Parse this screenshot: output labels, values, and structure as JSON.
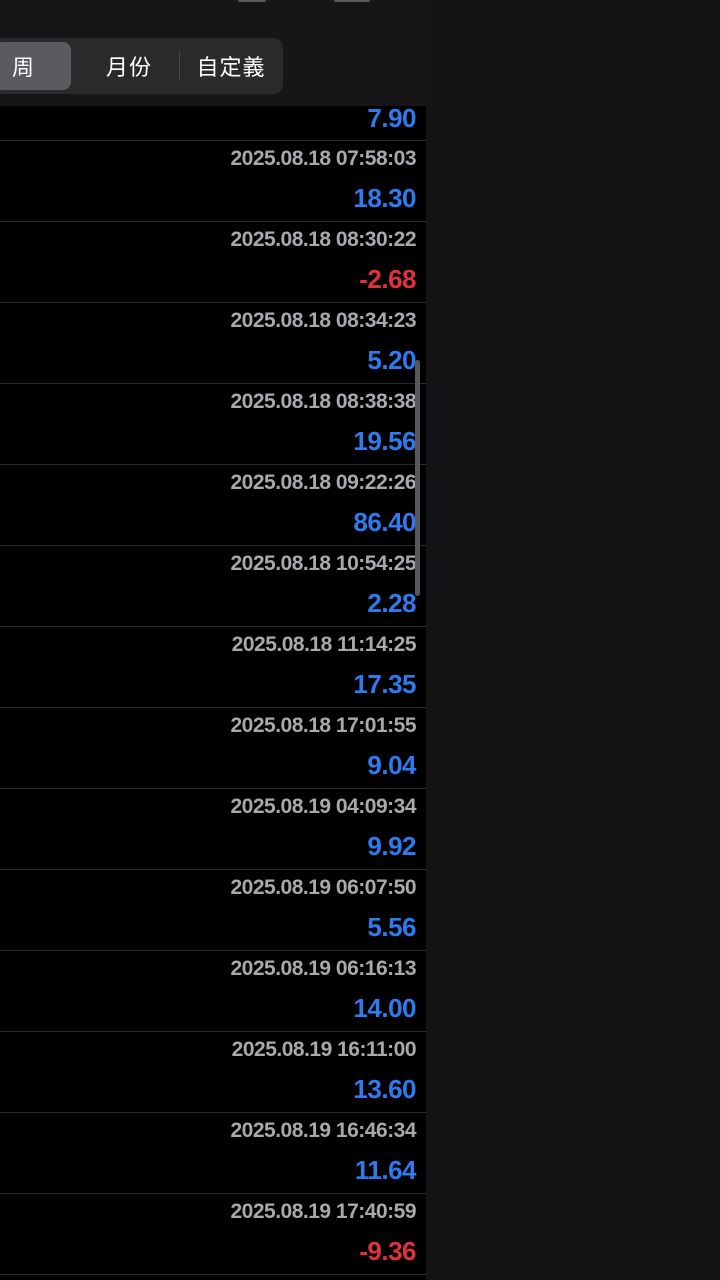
{
  "period_selector": {
    "week_label": "周",
    "month_label": "月份",
    "custom_label": "自定義",
    "selected": "week"
  },
  "colors": {
    "positive": "#2e7bf0",
    "negative": "#e0323c"
  },
  "first_row_value": "7.90",
  "rows": [
    {
      "timestamp": "2025.08.18 07:58:03",
      "profit": "18.30",
      "sign": "pos"
    },
    {
      "timestamp": "2025.08.18 08:30:22",
      "profit": "-2.68",
      "sign": "neg"
    },
    {
      "timestamp": "2025.08.18 08:34:23",
      "profit": "5.20",
      "sign": "pos"
    },
    {
      "timestamp": "2025.08.18 08:38:38",
      "profit": "19.56",
      "sign": "pos"
    },
    {
      "timestamp": "2025.08.18 09:22:26",
      "profit": "86.40",
      "sign": "pos"
    },
    {
      "timestamp": "2025.08.18 10:54:25",
      "profit": "2.28",
      "sign": "pos"
    },
    {
      "timestamp": "2025.08.18 11:14:25",
      "profit": "17.35",
      "sign": "pos"
    },
    {
      "timestamp": "2025.08.18 17:01:55",
      "profit": "9.04",
      "sign": "pos"
    },
    {
      "timestamp": "2025.08.19 04:09:34",
      "profit": "9.92",
      "sign": "pos"
    },
    {
      "timestamp": "2025.08.19 06:07:50",
      "profit": "5.56",
      "sign": "pos"
    },
    {
      "timestamp": "2025.08.19 06:16:13",
      "profit": "14.00",
      "sign": "pos"
    },
    {
      "timestamp": "2025.08.19 16:11:00",
      "profit": "13.60",
      "sign": "pos"
    },
    {
      "timestamp": "2025.08.19 16:46:34",
      "profit": "11.64",
      "sign": "pos"
    },
    {
      "timestamp": "2025.08.19 17:40:59",
      "profit": "-9.36",
      "sign": "neg"
    }
  ]
}
